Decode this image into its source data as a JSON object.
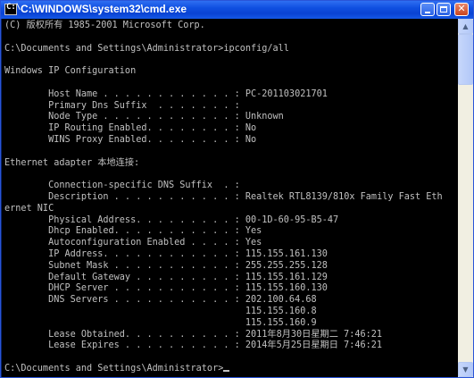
{
  "window": {
    "title": "C:\\WINDOWS\\system32\\cmd.exe",
    "icon_name": "cmd-icon",
    "minimize_label": "",
    "close_glyph": "✕"
  },
  "console": {
    "lines": [
      "(C) 版权所有 1985-2001 Microsoft Corp.",
      "",
      "C:\\Documents and Settings\\Administrator>ipconfig/all",
      "",
      "Windows IP Configuration",
      "",
      "        Host Name . . . . . . . . . . . . : PC-201103021701",
      "        Primary Dns Suffix  . . . . . . . :",
      "        Node Type . . . . . . . . . . . . : Unknown",
      "        IP Routing Enabled. . . . . . . . : No",
      "        WINS Proxy Enabled. . . . . . . . : No",
      "",
      "Ethernet adapter 本地连接:",
      "",
      "        Connection-specific DNS Suffix  . :",
      "        Description . . . . . . . . . . . : Realtek RTL8139/810x Family Fast Eth",
      "ernet NIC",
      "        Physical Address. . . . . . . . . : 00-1D-60-95-B5-47",
      "        Dhcp Enabled. . . . . . . . . . . : Yes",
      "        Autoconfiguration Enabled . . . . : Yes",
      "        IP Address. . . . . . . . . . . . : 115.155.161.130",
      "        Subnet Mask . . . . . . . . . . . : 255.255.255.128",
      "        Default Gateway . . . . . . . . . : 115.155.161.129",
      "        DHCP Server . . . . . . . . . . . : 115.155.160.130",
      "        DNS Servers . . . . . . . . . . . : 202.100.64.68",
      "                                            115.155.160.8",
      "                                            115.155.160.9",
      "        Lease Obtained. . . . . . . . . . : 2011年8月30日星期二 7:46:21",
      "        Lease Expires . . . . . . . . . . : 2014年5月25日星期日 7:46:21",
      "",
      "C:\\Documents and Settings\\Administrator>"
    ]
  },
  "scrollbar": {
    "up_glyph": "▲",
    "down_glyph": "▼",
    "position_fraction": 0.0
  },
  "colors": {
    "console_bg": "#000000",
    "console_fg": "#c0c0c0",
    "titlebar": "#0a43d3"
  }
}
